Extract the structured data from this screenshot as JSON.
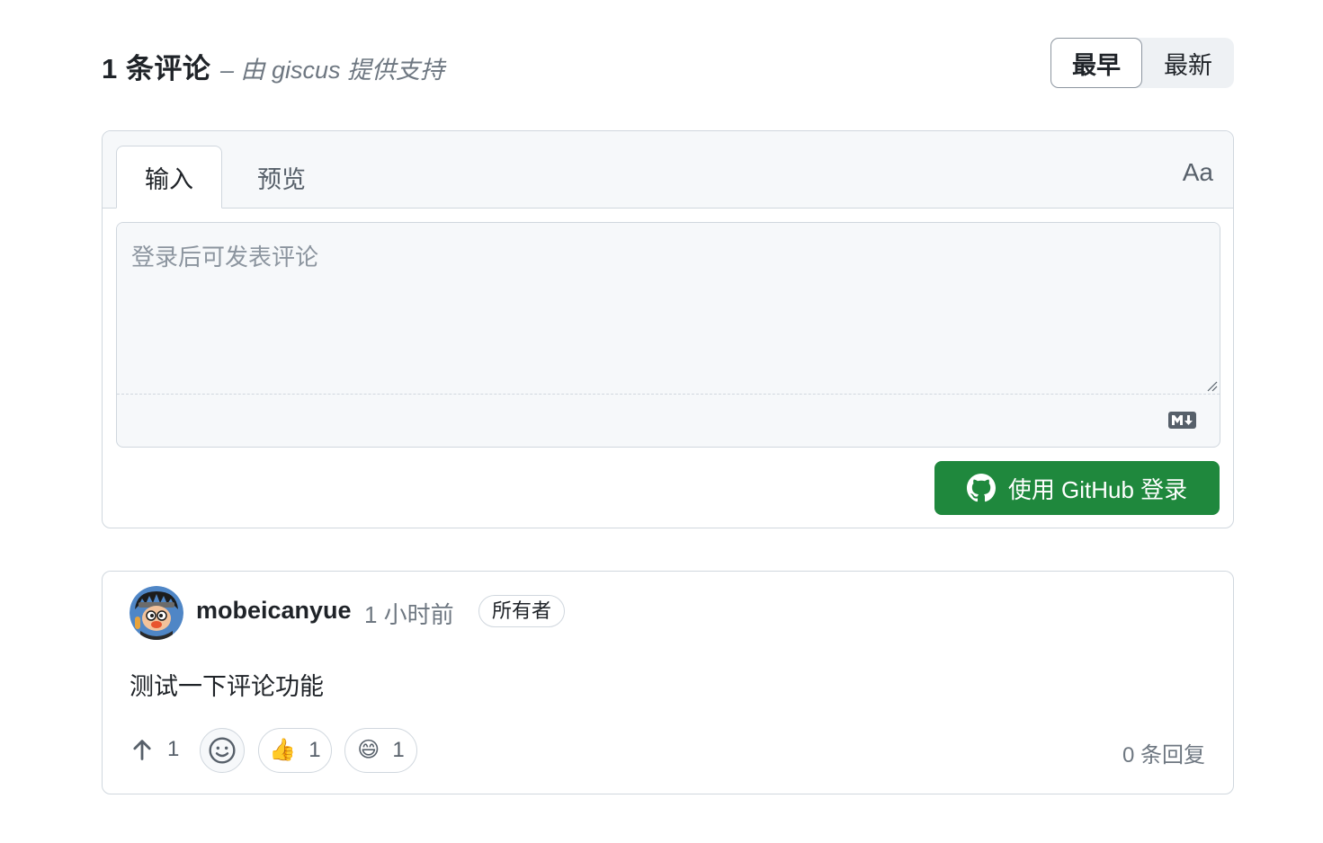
{
  "header": {
    "comment_count": "1 条评论",
    "powered_by": "– 由 giscus 提供支持",
    "sort": {
      "oldest": "最早",
      "newest": "最新",
      "active": "oldest"
    }
  },
  "editor": {
    "tabs": [
      {
        "label": "输入",
        "active": true
      },
      {
        "label": "预览",
        "active": false
      }
    ],
    "font_toggle": "Aa",
    "placeholder": "登录后可发表评论",
    "markdown_icon": "markdown-icon",
    "login_button": "使用 GitHub 登录",
    "login_icon": "github-icon"
  },
  "comment": {
    "author": "mobeicanyue",
    "time": "1 小时前",
    "badge": "所有者",
    "body": "测试一下评论功能",
    "upvotes": "1",
    "reactions": [
      {
        "emoji": "👍",
        "count": "1"
      },
      {
        "emoji": "😄",
        "count": "1"
      }
    ],
    "replies": "0 条回复"
  },
  "colors": {
    "accent_green": "#1f883d",
    "border": "#d0d7de",
    "muted_text": "#6e7781"
  }
}
